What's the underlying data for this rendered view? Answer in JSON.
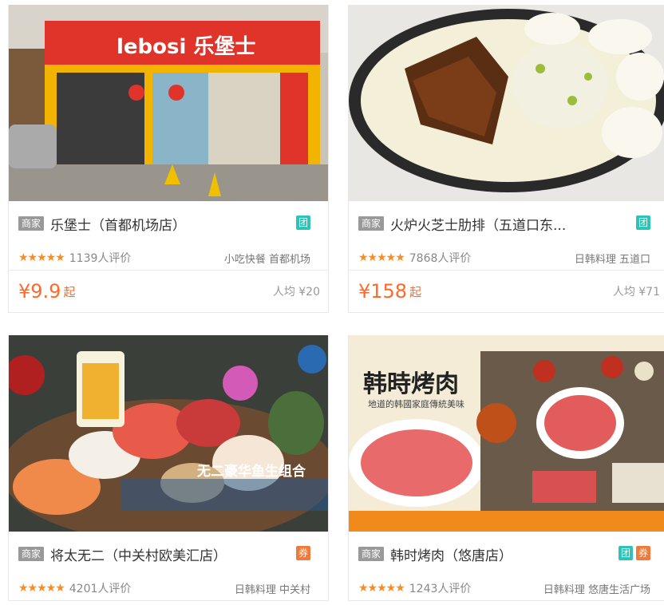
{
  "cards": [
    {
      "name": "乐堡士（首都机场店）",
      "shop_tag": "商家",
      "rating": "★★★★★",
      "reviews": "1139人评价",
      "tags": "小吃快餐 首都机场",
      "price": "¥9.9",
      "price_suffix": "起",
      "avg": "人均 ¥20",
      "badges": [
        "团"
      ],
      "image_sign": "lebosi 乐堡士"
    },
    {
      "name": "火炉火芝士肋排（五道口东...",
      "shop_tag": "商家",
      "rating": "★★★★★",
      "reviews": "7868人评价",
      "tags": "日韩料理 五道口",
      "price": "¥158",
      "price_suffix": "起",
      "avg": "人均 ¥71",
      "badges": [
        "团"
      ]
    },
    {
      "name": "将太无二（中关村欧美汇店）",
      "shop_tag": "商家",
      "rating": "★★★★★",
      "reviews": "4201人评价",
      "tags": "日韩料理 中关村",
      "badges": [
        "券"
      ],
      "image_caption": "无二豪华鱼生组合"
    },
    {
      "name": "韩时烤肉（悠唐店）",
      "shop_tag": "商家",
      "rating": "★★★★★",
      "reviews": "1243人评价",
      "tags": "日韩料理 悠唐生活广场",
      "badges": [
        "团",
        "券"
      ],
      "image_title": "韩時烤肉",
      "image_subtitle": "地道的韩國家庭傳統美味"
    }
  ]
}
